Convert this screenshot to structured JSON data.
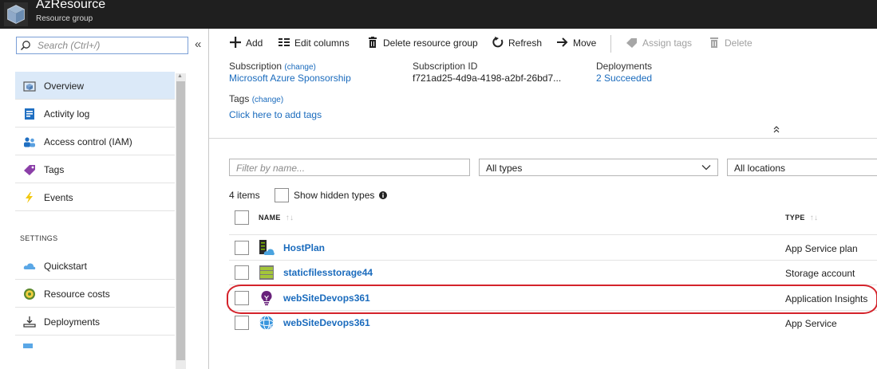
{
  "header": {
    "title": "AzResource",
    "subtitle": "Resource group"
  },
  "sidebar": {
    "search_placeholder": "Search (Ctrl+/)",
    "collapse_glyph": "«",
    "items": [
      {
        "label": "Overview",
        "icon": "overview-icon",
        "selected": true
      },
      {
        "label": "Activity log",
        "icon": "activity-log-icon"
      },
      {
        "label": "Access control (IAM)",
        "icon": "iam-icon"
      },
      {
        "label": "Tags",
        "icon": "tag-icon"
      },
      {
        "label": "Events",
        "icon": "lightning-icon"
      }
    ],
    "settings_heading": "SETTINGS",
    "settings_items": [
      {
        "label": "Quickstart",
        "icon": "cloud-icon"
      },
      {
        "label": "Resource costs",
        "icon": "cost-icon"
      },
      {
        "label": "Deployments",
        "icon": "deployments-icon"
      }
    ]
  },
  "toolbar": {
    "add": "Add",
    "edit_columns": "Edit columns",
    "delete_group": "Delete resource group",
    "refresh": "Refresh",
    "move": "Move",
    "assign_tags": "Assign tags",
    "delete": "Delete"
  },
  "essentials": {
    "subscription_label": "Subscription",
    "change": "(change)",
    "subscription_value": "Microsoft Azure Sponsorship",
    "subscription_id_label": "Subscription ID",
    "subscription_id_value": "f721ad25-4d9a-4198-a2bf-26bd7...",
    "deployments_label": "Deployments",
    "deployments_value": "2 Succeeded",
    "tags_label": "Tags",
    "tags_link": "Click here to add tags",
    "collapse_glyph": "«"
  },
  "filters": {
    "name_placeholder": "Filter by name...",
    "types_value": "All types",
    "locations_value": "All locations"
  },
  "list": {
    "count": "4 items",
    "show_hidden": "Show hidden types",
    "col_name": "NAME",
    "col_type": "TYPE",
    "sort_glyph": "↑↓",
    "rows": [
      {
        "name": "HostPlan",
        "type": "App Service plan",
        "icon": "app-service-plan-icon"
      },
      {
        "name": "staticfilesstorage44",
        "type": "Storage account",
        "icon": "storage-account-icon"
      },
      {
        "name": "webSiteDevops361",
        "type": "Application Insights",
        "icon": "app-insights-icon",
        "highlighted": true
      },
      {
        "name": "webSiteDevops361",
        "type": "App Service",
        "icon": "app-service-icon"
      }
    ]
  }
}
